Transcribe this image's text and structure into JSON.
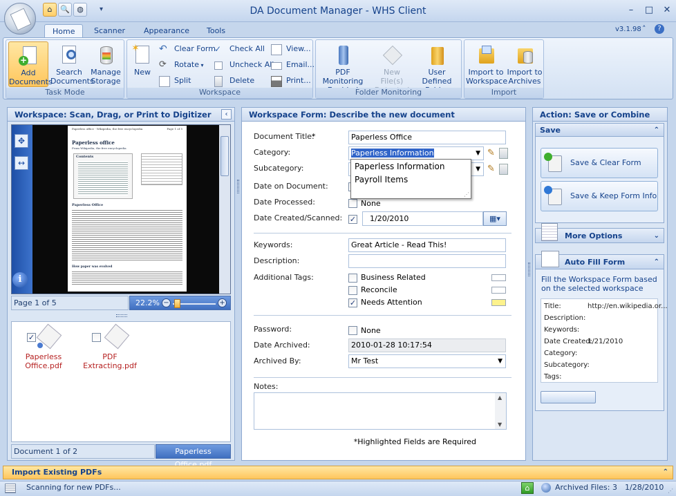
{
  "window": {
    "title": "DA Document Manager - WHS Client",
    "version": "v3.1.98",
    "min_glyph": "–",
    "max_glyph": "□",
    "close_glyph": "✕"
  },
  "quick_access": {
    "menu_glyph": "▾"
  },
  "ribbon": {
    "tabs": [
      "Home",
      "Scanner",
      "Appearance",
      "Tools"
    ],
    "groups": {
      "task_mode": {
        "label": "Task Mode",
        "add": "Add Documents",
        "search": "Search Documents",
        "manage": "Manage Storage"
      },
      "workspace": {
        "label": "Workspace",
        "new": "New",
        "clear_form": "Clear Form",
        "rotate": "Rotate",
        "split": "Split",
        "check_all": "Check All",
        "uncheck_all": "Uncheck All",
        "delete": "Delete",
        "view": "View...",
        "email": "Email...",
        "print": "Print..."
      },
      "folder_monitoring": {
        "label": "Folder Monitoring",
        "pdf_monitoring": "PDF Monitoring Enabled",
        "new_files": "New File(s) Detected",
        "user_defined": "User Defined Folder"
      },
      "import": {
        "label": "Import",
        "to_workspace": "Import to Workspace",
        "to_archives": "Import to Archives"
      }
    }
  },
  "left": {
    "header": "Workspace:  Scan, Drag, or Print to Digitizer",
    "page_info": "Page 1 of 5",
    "zoom": "22.2%",
    "doc_header_line1": "Paperless office - Wikipedia, the free encyclopedia",
    "doc_header_page": "Page 1 of 5",
    "doc_title": "Paperless office",
    "doc_subtitle": "From Wikipedia, the free encyclopedia",
    "doc_toc": "Contents",
    "doc_section": "Paperless Office",
    "doc_section2": "How paper was evolved",
    "files": [
      {
        "name": "Paperless Office.pdf",
        "checked": true
      },
      {
        "name": "PDF Extracting.pdf",
        "checked": false
      }
    ],
    "doc_count": "Document 1 of 2",
    "selected_file": "Paperless Office.pdf"
  },
  "form": {
    "header": "Workspace Form:  Describe the new document",
    "title_label": "Document Title:",
    "required_star": "*",
    "title_value": "Paperless Office",
    "category_label": "Category:",
    "category_value": "Paperless Information",
    "category_options": [
      "Paperless Information",
      "Payroll Items"
    ],
    "subcategory_label": "Subcategory:",
    "date_on_doc_label": "Date on Document:",
    "date_processed_label": "Date Processed:",
    "none_label": "None",
    "date_created_label": "Date Created/Scanned:",
    "date_created_value": "1/20/2010",
    "keywords_label": "Keywords:",
    "keywords_value": "Great Article - Read This!",
    "description_label": "Description:",
    "tags_label": "Additional Tags:",
    "tags": [
      {
        "name": "Business Related",
        "checked": false,
        "color": "#ffffff"
      },
      {
        "name": "Reconcile",
        "checked": false,
        "color": "#ffffff"
      },
      {
        "name": "Needs Attention",
        "checked": true,
        "color": "#fdf28c"
      }
    ],
    "password_label": "Password:",
    "password_none": "None",
    "archived_label": "Date Archived:",
    "archived_value": "2010-01-28 10:17:54",
    "archived_by_label": "Archived By:",
    "archived_by_value": "Mr Test",
    "notes_label": "Notes:",
    "required_note": "*Highlighted Fields are Required"
  },
  "action": {
    "header": "Action:  Save or Combine",
    "save_section": "Save",
    "save_clear": "Save & Clear Form Info",
    "save_keep": "Save & Keep Form Info",
    "more_options": "More Options",
    "auto_fill": "Auto Fill Form",
    "auto_fill_desc": "Fill the Workspace Form based on the selected workspace",
    "fields": [
      {
        "k": "Title:",
        "v": "http://en.wikipedia.or..."
      },
      {
        "k": "Description:",
        "v": ""
      },
      {
        "k": "Keywords:",
        "v": ""
      },
      {
        "k": "Date Created:",
        "v": "1/21/2010"
      },
      {
        "k": "Category:",
        "v": ""
      },
      {
        "k": "Subcategory:",
        "v": ""
      },
      {
        "k": "Tags:",
        "v": ""
      }
    ]
  },
  "import_bar": "Import Existing PDFs",
  "status": {
    "text": "Scanning for new PDFs...",
    "archived": "Archived Files: 3",
    "date": "1/28/2010"
  }
}
